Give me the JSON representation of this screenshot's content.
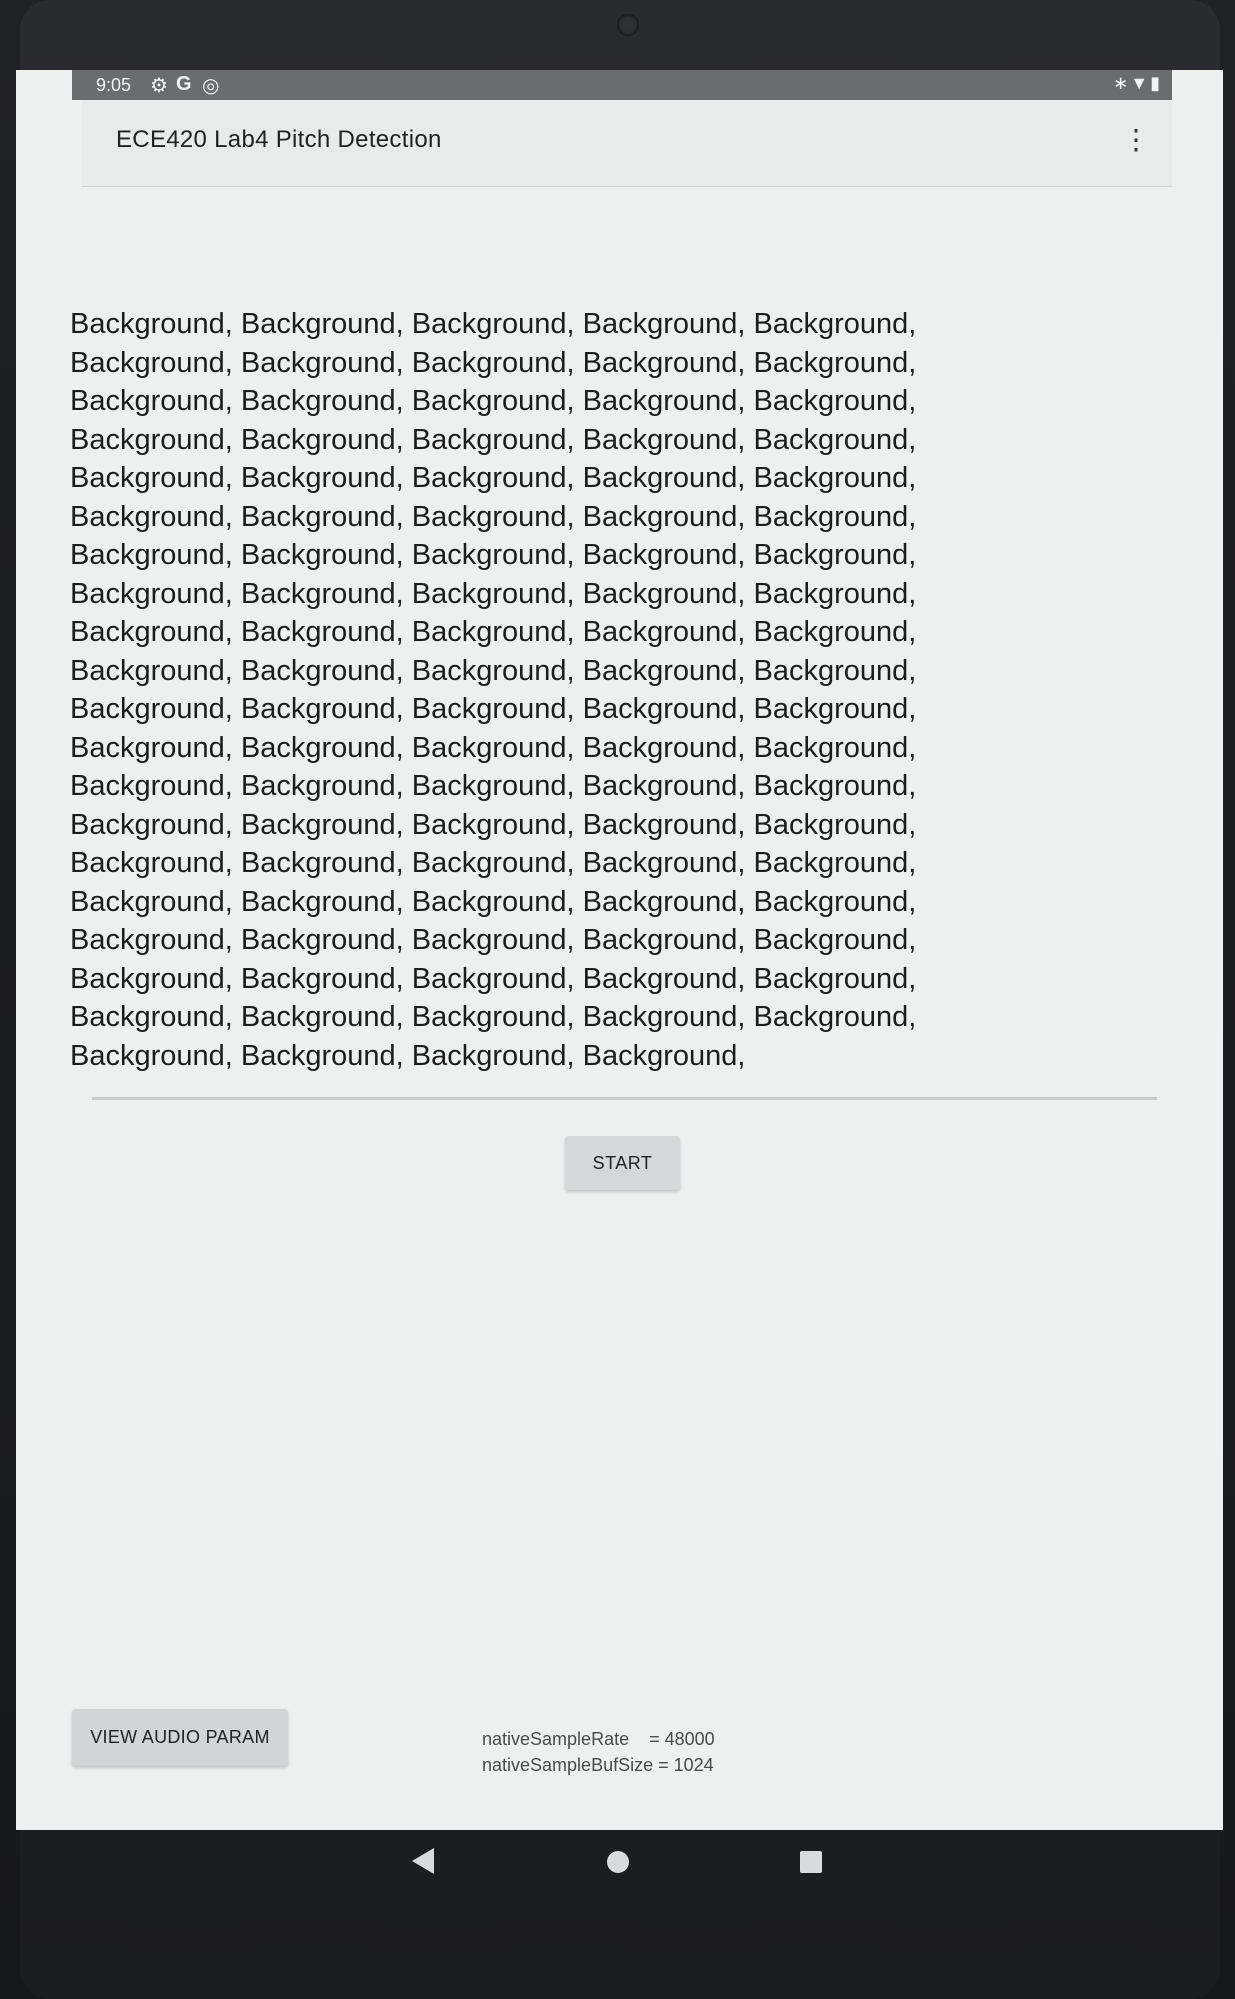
{
  "status_bar": {
    "time": "9:05",
    "left_icons": [
      "gear-icon",
      "google-icon",
      "sync-icon"
    ],
    "right_icons": [
      "bluetooth-icon",
      "wifi-icon",
      "battery-icon"
    ]
  },
  "app_bar": {
    "title": "ECE420 Lab4 Pitch Detection",
    "overflow_icon": "more-vert-icon"
  },
  "content": {
    "lines": [
      "Background, Background, Background, Background, Background,",
      "Background, Background, Background, Background, Background,",
      "Background, Background, Background, Background, Background,",
      "Background, Background, Background, Background, Background,",
      "Background, Background, Background, Background, Background,",
      "Background, Background, Background, Background, Background,",
      "Background, Background, Background, Background, Background,",
      "Background, Background, Background, Background, Background,",
      "Background, Background, Background, Background, Background,",
      "Background, Background, Background, Background, Background,",
      "Background, Background, Background, Background, Background,",
      "Background, Background, Background, Background, Background,",
      "Background, Background, Background, Background, Background,",
      "Background, Background, Background, Background, Background,",
      "Background, Background, Background, Background, Background,",
      "Background, Background, Background, Background, Background,",
      "Background, Background, Background, Background, Background,",
      "Background, Background, Background, Background, Background,",
      "Background, Background, Background, Background, Background,",
      "Background, Background, Background, Background,"
    ]
  },
  "buttons": {
    "start": "START",
    "view_audio_param": "VIEW AUDIO PARAM"
  },
  "audio_params": {
    "sample_rate_line": "nativeSampleRate    = 48000",
    "buf_size_line": "nativeSampleBufSize = 1024"
  },
  "nav_bar": {
    "icons": [
      "back-icon",
      "home-icon",
      "recents-icon"
    ]
  },
  "colors": {
    "status_bar": "#6a6c6e",
    "app_bar": "#e9eaea",
    "screen_bg": "#eef0ef",
    "button_bg": "#d6d7d8"
  }
}
